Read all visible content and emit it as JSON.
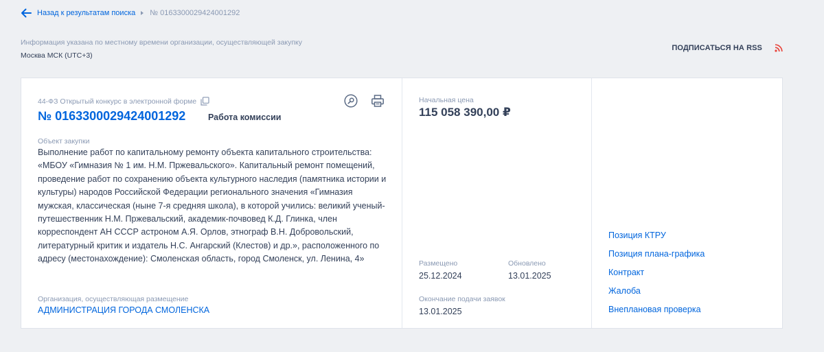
{
  "breadcrumb": {
    "back_label": "Назад к результатам поиска",
    "current": "№ 0163300029424001292"
  },
  "timezone": {
    "note": "Информация указана по местному времени организации, осуществляющей закупку",
    "value": "Москва МСК (UTC+3)"
  },
  "rss": {
    "label": "ПОДПИСАТЬСЯ НА RSS",
    "icon": "rss-icon",
    "icon_color": "#e8453c"
  },
  "procurement": {
    "type": "44-ФЗ Открытый конкурс в электронной форме",
    "number": "№ 0163300029424001292",
    "stage": "Работа комиссии",
    "object_label": "Объект закупки",
    "object_text": "Выполнение работ по капитальному ремонту объекта капитального строительства: «МБОУ «Гимназия № 1 им. Н.М. Пржевальского». Капитальный ремонт помещений, проведение работ по сохранению объекта культурного наследия (памятника истории и культуры) народов Российской Федерации регионального значения «Гимназия мужская, классическая (ныне 7-я средняя школа), в которой учились: великий ученый-путешественник Н.М. Пржевальский, академик-почвовед К.Д. Глинка, член корреспондент АН СССР астроном А.Я. Орлов, этнограф В.Н. Добровольский, литературный критик и издатель Н.С. Ангарский (Клестов) и др.», расположенного по адресу (местонахождение): Смоленская область, город Смоленск, ул. Ленина, 4»",
    "org_label": "Организация, осуществляющая размещение",
    "org_name": "АДМИНИСТРАЦИЯ ГОРОДА СМОЛЕНСКА"
  },
  "price": {
    "label": "Начальная цена",
    "value": "115 058 390,00 ₽"
  },
  "dates": {
    "posted_label": "Размещено",
    "posted_value": "25.12.2024",
    "updated_label": "Обновлено",
    "updated_value": "13.01.2025",
    "deadline_label": "Окончание подачи заявок",
    "deadline_value": "13.01.2025"
  },
  "links": [
    "Позиция КТРУ",
    "Позиция плана-графика",
    "Контракт",
    "Жалоба",
    "Внеплановая проверка"
  ],
  "colors": {
    "accent": "#0065dd",
    "text": "#334059",
    "muted": "#8a99b3",
    "background": "#eef0f3"
  }
}
